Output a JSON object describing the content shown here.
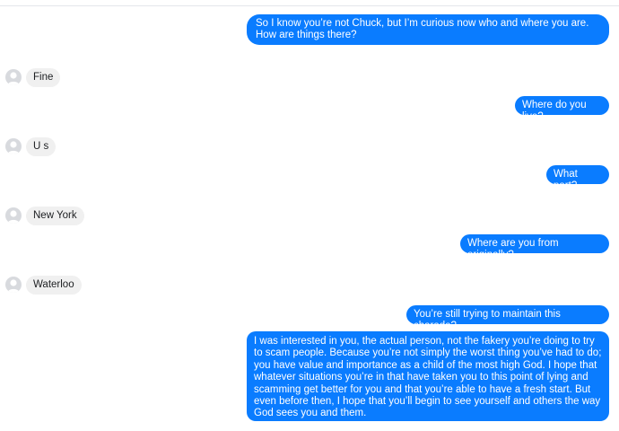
{
  "conversation": {
    "messages": [
      {
        "sender": "me",
        "text": "So I know you’re not Chuck, but I’m curious now who and where you are. How are things there?"
      },
      {
        "sender": "them",
        "text": "Fine"
      },
      {
        "sender": "me",
        "text": "Where do you live?"
      },
      {
        "sender": "them",
        "text": "U s"
      },
      {
        "sender": "me",
        "text": "What part?"
      },
      {
        "sender": "them",
        "text": "New York"
      },
      {
        "sender": "me",
        "text": "Where are you from originally?"
      },
      {
        "sender": "them",
        "text": "Waterloo"
      },
      {
        "sender": "me",
        "text": "You’re still trying to maintain this charade?"
      },
      {
        "sender": "me",
        "text": "I was interested in you, the actual person, not the fakery you’re doing to try to scam people. Because you’re not simply the worst thing you’ve had to do; you have value and importance as a child of the most high God. I hope that whatever situations you’re in that have taken you to this point of lying and scamming get better for you and that you’re able to have a fresh start. But even before then, I hope that you’ll begin to see yourself and others the way God sees you and them."
      }
    ]
  },
  "colors": {
    "outgoing_bubble": "#0a7cff",
    "incoming_bubble": "#f0f0f0"
  },
  "icons": {
    "avatar": "default-profile-avatar-icon"
  }
}
